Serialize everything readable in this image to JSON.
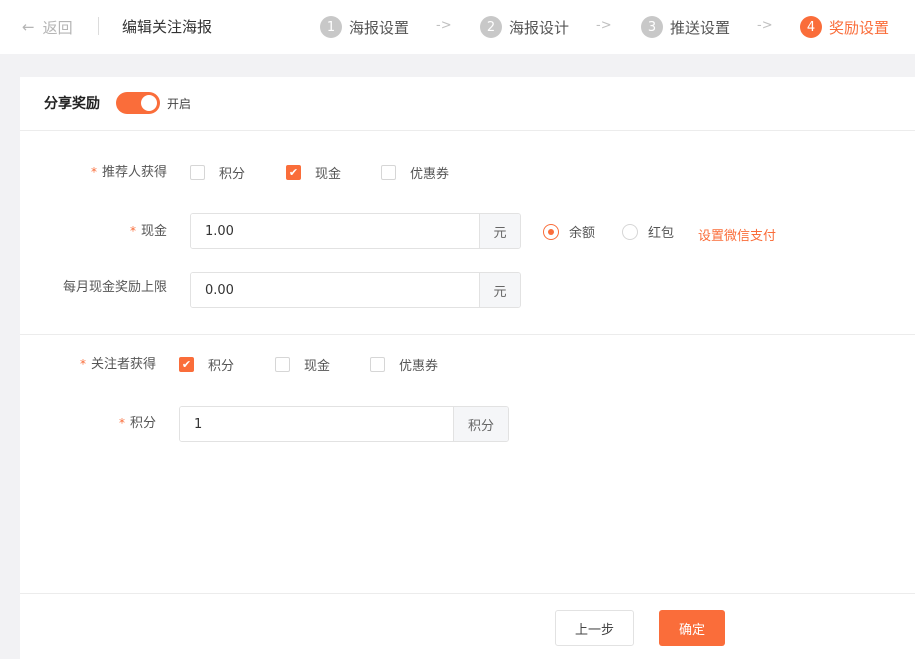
{
  "header": {
    "back_label": "返回",
    "title": "编辑关注海报",
    "steps": [
      {
        "num": "1",
        "label": "海报设置"
      },
      {
        "num": "2",
        "label": "海报设计"
      },
      {
        "num": "3",
        "label": "推送设置"
      },
      {
        "num": "4",
        "label": "奖励设置"
      }
    ],
    "active_step": 4
  },
  "share": {
    "title": "分享奖励",
    "toggle_on": true,
    "toggle_label": "开启"
  },
  "referrer": {
    "label": "推荐人获得",
    "options": [
      {
        "label": "积分",
        "checked": false
      },
      {
        "label": "现金",
        "checked": true
      },
      {
        "label": "优惠券",
        "checked": false
      }
    ],
    "cash_label": "现金",
    "cash_value": "1.00",
    "cash_unit": "元",
    "pay_options": [
      {
        "label": "余额",
        "checked": true
      },
      {
        "label": "红包",
        "checked": false
      }
    ],
    "wechat_link": "设置微信支付",
    "monthly_limit_label": "每月现金奖励上限",
    "monthly_limit_value": "0.00",
    "monthly_limit_unit": "元"
  },
  "follower": {
    "label": "关注者获得",
    "options": [
      {
        "label": "积分",
        "checked": true
      },
      {
        "label": "现金",
        "checked": false
      },
      {
        "label": "优惠券",
        "checked": false
      }
    ],
    "points_label": "积分",
    "points_value": "1",
    "points_unit": "积分"
  },
  "footer": {
    "prev_label": "上一步",
    "confirm_label": "确定"
  },
  "colors": {
    "accent": "#fa6d3a",
    "background": "#f2f2f4"
  }
}
